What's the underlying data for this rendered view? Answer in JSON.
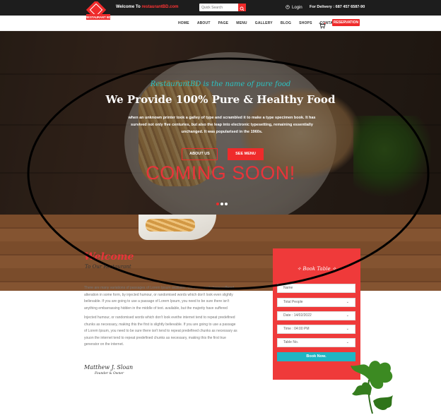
{
  "topbar": {
    "welcome_prefix": "Welcome To ",
    "welcome_site": "restaurantBD.com",
    "search_placeholder": "Quick Search",
    "login": "Login",
    "delivery": "For Delivery : 687 457 6587-90"
  },
  "logo": {
    "text": "RESTAURANT BD"
  },
  "nav": {
    "items": [
      "HOME",
      "ABOUT",
      "PAGE",
      "MENU",
      "GALLERY",
      "BLOG",
      "SHOPS",
      "CONTACT"
    ],
    "reservation": "RESERVATION"
  },
  "hero": {
    "tagline": "RestaurantBD is the name of pure food",
    "heading": "We Provide 100% Pure & Healthy Food",
    "description": "when an unknown printer took a galley of type and scrambled it to make a type specimen book. It has survived not only five centuries, but also the leap into electronic typesetting, remaining essentially unchanged. It was popularised in the 1960s.",
    "about_button": "ABOUT US",
    "menu_button": "SEE MENU",
    "overlay_text": "COMING SOON!"
  },
  "welcome": {
    "title": "Welcome",
    "subtitle": "To Our Restaurant",
    "para1": "There are many variations of passages of Lorem Ipsum available, but the majority have suffered alteration in some form, by injected humour, or randomised words which don't look even slightly believable. If you are going to use a passage of Lorem Ipsum, you need to be sure there isn't anything embarrassing hidden in the middle of text. available, but the majority have suffered alteration in some form.",
    "para2": "Injected humour, or randomised words which don't look evethe internet tend to repeat predefined chunks as necessary, making this the first is slightly believable. If you are going to use a passage of Lorem Ipsum, you need to be sure there isn't tend to repeat predefined chunks as necessary as youon the internet tend to repeat predefined chunks as necessary, making this the first true generator on the internet.",
    "signature": "Matthew J. Sloan",
    "role": "Founder & Owner"
  },
  "booking": {
    "title": "Book Table",
    "name_placeholder": "Name",
    "people": "Total People",
    "date": "Date : 14/02/2022",
    "time": "Time : 04:00 PM",
    "table": "Table No.",
    "submit": "Book Now."
  },
  "colors": {
    "accent": "#ef2b2b",
    "teal": "#1fb5c3",
    "dark": "#1d1d1d"
  }
}
